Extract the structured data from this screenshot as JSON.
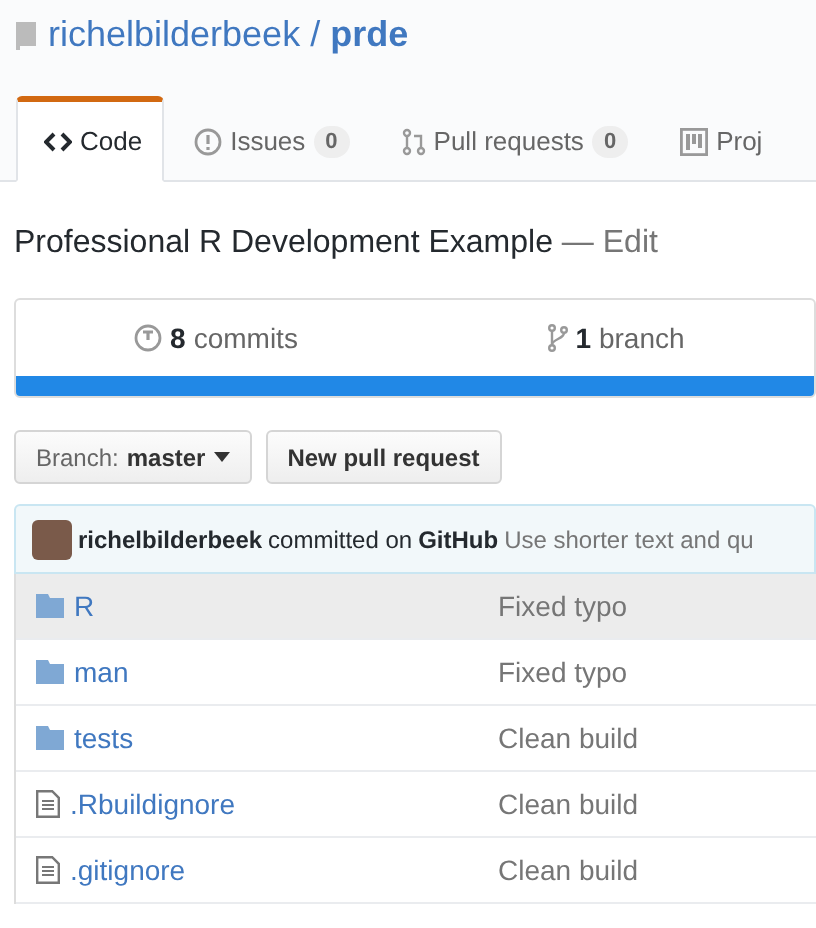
{
  "repo": {
    "owner": "richelbilderbeek",
    "separator": "/",
    "name": "prde"
  },
  "tabs": [
    {
      "kind": "code",
      "label": "Code",
      "selected": true
    },
    {
      "kind": "issues",
      "label": "Issues",
      "count": "0",
      "selected": false
    },
    {
      "kind": "pulls",
      "label": "Pull requests",
      "count": "0",
      "selected": false
    },
    {
      "kind": "projects",
      "label": "Proj",
      "selected": false
    }
  ],
  "description": {
    "text": "Professional R Development Example",
    "edit": "— Edit"
  },
  "stats": [
    {
      "kind": "commits",
      "number": "8",
      "label": "commits"
    },
    {
      "kind": "branches",
      "number": "1",
      "label": "branch"
    }
  ],
  "branch_button": {
    "label": "Branch:",
    "value": "master"
  },
  "new_pull_request": "New pull request",
  "commit": {
    "author": "richelbilderbeek",
    "action": "committed on",
    "service": "GitHub",
    "message": "Use shorter text and qu"
  },
  "files": [
    {
      "kind": "folder",
      "name": "R",
      "message": "Fixed typo",
      "highlighted": true
    },
    {
      "kind": "folder",
      "name": "man",
      "message": "Fixed typo",
      "highlighted": false
    },
    {
      "kind": "folder",
      "name": "tests",
      "message": "Clean build",
      "highlighted": false
    },
    {
      "kind": "file",
      "name": ".Rbuildignore",
      "message": "Clean build",
      "highlighted": false
    },
    {
      "kind": "file",
      "name": ".gitignore",
      "message": "Clean build",
      "highlighted": false
    }
  ]
}
